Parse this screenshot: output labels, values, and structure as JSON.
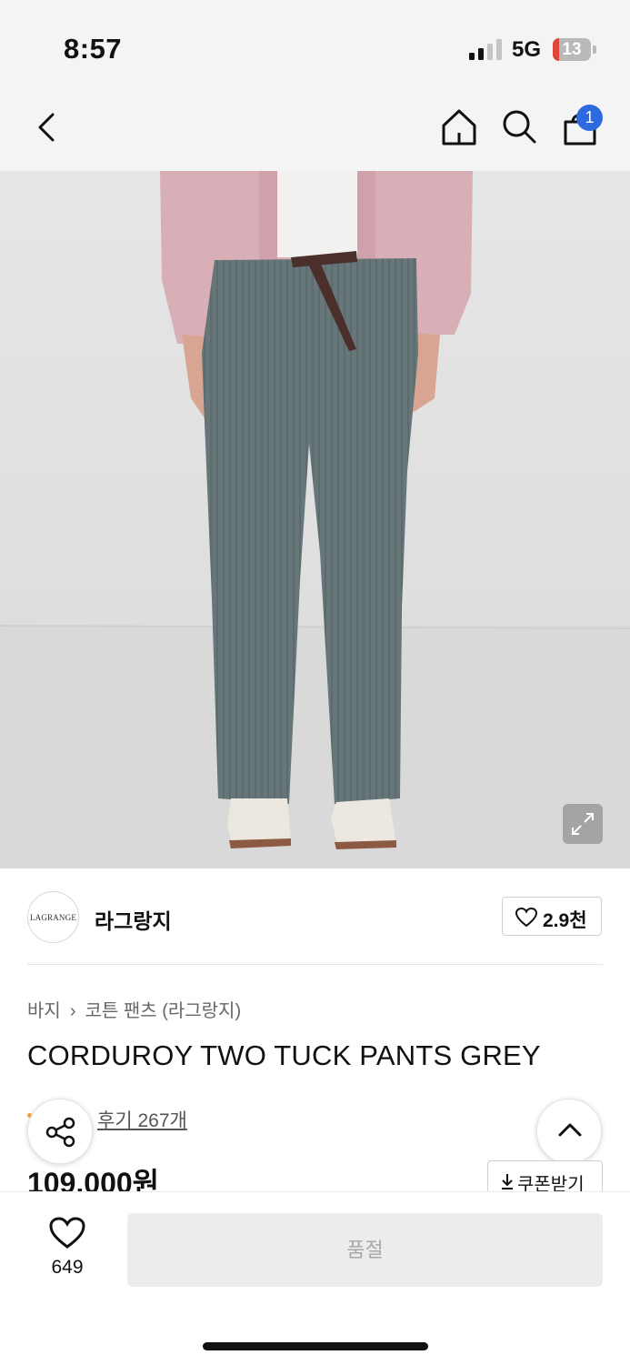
{
  "status_bar": {
    "time": "8:57",
    "network": "5G",
    "battery": "13"
  },
  "header": {
    "icons": [
      "back-arrow-icon",
      "home-icon",
      "search-icon",
      "shopping-bag-icon"
    ],
    "cart_badge": "1"
  },
  "product_image": {
    "description_icon": "expand-icon"
  },
  "brand": {
    "logo_text": "LAGRANGE",
    "name": "라그랑지",
    "like_count": "2.9천"
  },
  "breadcrumb": {
    "category": "바지",
    "subcategory": "코튼 팬츠 (라그랑지)"
  },
  "product": {
    "title": "CORDUROY TWO TUCK PANTS GREY",
    "review_link": "후기 267개",
    "price": "109,000원",
    "coupon_label": "쿠폰받기"
  },
  "bottom_bar": {
    "wish_count": "649",
    "action_label": "품절"
  },
  "colors": {
    "accent_badge": "#2d6ae0",
    "battery_low": "#e0453a",
    "soldout_bg": "#ececec",
    "soldout_text": "#a9a9a9"
  }
}
